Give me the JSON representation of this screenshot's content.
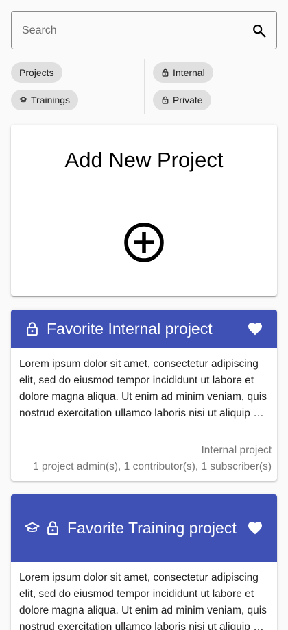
{
  "search": {
    "placeholder": "Search",
    "value": ""
  },
  "filters": {
    "left": [
      {
        "label": "Projects",
        "icon": ""
      },
      {
        "label": "Trainings",
        "icon": "graduation-cap-icon"
      }
    ],
    "right": [
      {
        "label": "Internal",
        "icon": "lock-icon"
      },
      {
        "label": "Private",
        "icon": "lock-icon"
      }
    ]
  },
  "add_card": {
    "title": "Add New Project",
    "icon": "add-circle-icon"
  },
  "projects": [
    {
      "title": "Favorite Internal project",
      "icons": [
        "lock-icon"
      ],
      "favorite": true,
      "description": "Lorem ipsum dolor sit amet, consectetur adipiscing elit, sed do eiusmod tempor incididunt ut labore et dolore magna aliqua. Ut enim ad minim veniam, quis nostrud exercitation ullamco laboris nisi ut aliquip ex ea commodo consequat.",
      "visibility": "Internal project",
      "members": "1 project admin(s), 1 contributor(s), 1 subscriber(s)"
    },
    {
      "title": "Favorite Training project",
      "icons": [
        "graduation-cap-icon",
        "lock-icon"
      ],
      "favorite": true,
      "description": "Lorem ipsum dolor sit amet, consectetur adipiscing elit, sed do eiusmod tempor incididunt ut labore et dolore magna aliqua. Ut enim ad minim veniam, quis nostrud exercitation ullamco laboris nisi ut aliquip ex ea commodo consequat."
    }
  ],
  "colors": {
    "accent": "#3f51b5",
    "chip_bg": "#e0e0e0",
    "meta_text": "#757575"
  }
}
